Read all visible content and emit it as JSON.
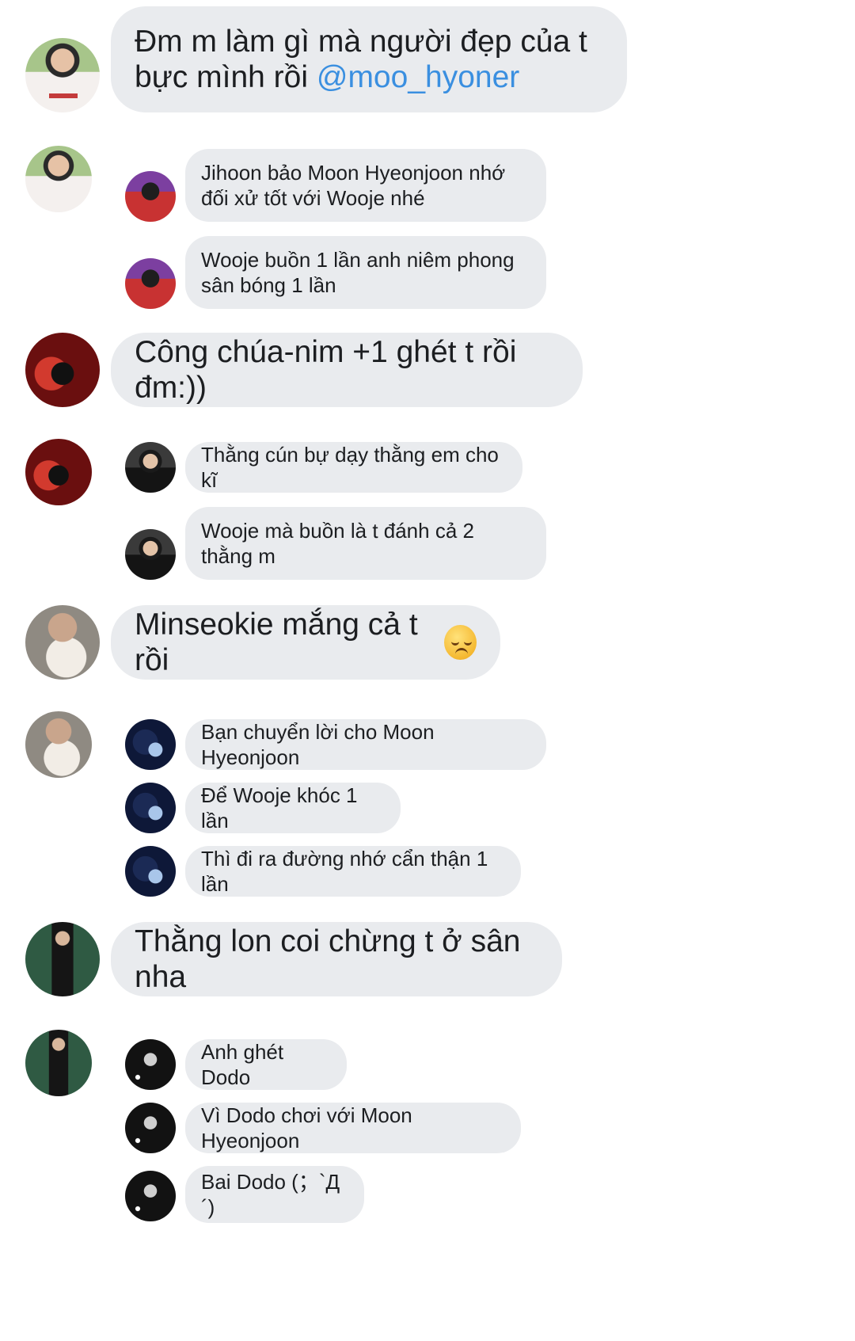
{
  "messages": [
    {
      "big": {
        "text": "Đm m làm gì mà người đẹp của t bực mình rồi",
        "mention": "@moo_hyoner"
      },
      "replies": [
        {
          "text": "Jihoon bảo Moon Hyeonjoon nhớ đối xử tốt với Wooje nhé"
        },
        {
          "text": "Wooje buồn 1 lần anh niêm phong sân bóng 1 lần"
        }
      ]
    },
    {
      "big": {
        "text": "Công chúa-nim +1 ghét t rồi đm:))"
      },
      "replies": [
        {
          "text": "Thằng cún bự dạy thằng em cho kĩ"
        },
        {
          "text": "Wooje mà buồn là t đánh cả 2 thằng m"
        }
      ]
    },
    {
      "big": {
        "text": "Minseokie mắng cả t rồi",
        "emoji": "disappointed-face-icon"
      },
      "replies": [
        {
          "text": "Bạn chuyển lời cho Moon Hyeonjoon"
        },
        {
          "text": "Để Wooje khóc 1 lần"
        },
        {
          "text": "Thì đi ra đường nhớ cẩn thận 1 lần"
        }
      ]
    },
    {
      "big": {
        "text": "Thằng lon coi chừng t ở sân nha"
      },
      "replies": [
        {
          "text": "Anh ghét Dodo"
        },
        {
          "text": "Vì Dodo chơi với Moon Hyeonjoon"
        },
        {
          "text": "Bai Dodo (；`Д´)"
        }
      ]
    }
  ],
  "colors": {
    "bubble": "#e9ebee",
    "mention": "#3a8fe0",
    "text": "#1c1e21"
  }
}
